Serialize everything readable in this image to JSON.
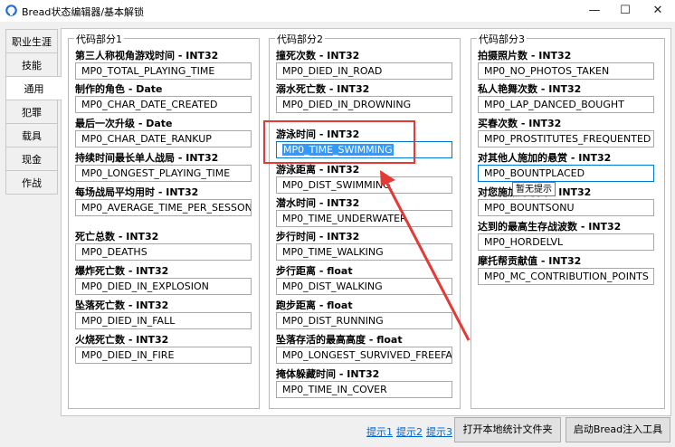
{
  "window": {
    "title": "Bread状态编辑器/基本解锁"
  },
  "tabs": [
    "职业生涯",
    "技能",
    "通用",
    "犯罪",
    "载具",
    "现金",
    "作战"
  ],
  "groups": [
    {
      "legend": "代码部分1",
      "fields": [
        {
          "label": "第三人称视角游戏时间 - INT32",
          "value": "MP0_TOTAL_PLAYING_TIME"
        },
        {
          "label": "制作的角色 - Date",
          "value": "MP0_CHAR_DATE_CREATED"
        },
        {
          "label": "最后一次升级 - Date",
          "value": "MP0_CHAR_DATE_RANKUP"
        },
        {
          "label": "持续时间最长单人战局 - INT32",
          "value": "MP0_LONGEST_PLAYING_TIME"
        },
        {
          "label": "每场战局平均用时 - INT32",
          "value": "MP0_AVERAGE_TIME_PER_SESSON"
        },
        {
          "label": "死亡总数 - INT32",
          "value": "MP0_DEATHS"
        },
        {
          "label": "爆炸死亡数 - INT32",
          "value": "MP0_DIED_IN_EXPLOSION"
        },
        {
          "label": "坠落死亡数 - INT32",
          "value": "MP0_DIED_IN_FALL"
        },
        {
          "label": "火烧死亡数 - INT32",
          "value": "MP0_DIED_IN_FIRE"
        }
      ]
    },
    {
      "legend": "代码部分2",
      "fields": [
        {
          "label": "撞死次数 - INT32",
          "value": "MP0_DIED_IN_ROAD"
        },
        {
          "label": "溺水死亡数 - INT32",
          "value": "MP0_DIED_IN_DROWNING"
        },
        {
          "label": "游泳时间 - INT32",
          "value": "MP0_TIME_SWIMMING"
        },
        {
          "label": "游泳距离 - INT32",
          "value": "MP0_DIST_SWIMMING"
        },
        {
          "label": "潜水时间 - INT32",
          "value": "MP0_TIME_UNDERWATER"
        },
        {
          "label": "步行时间 - INT32",
          "value": "MP0_TIME_WALKING"
        },
        {
          "label": "步行距离 - float",
          "value": "MP0_DIST_WALKING"
        },
        {
          "label": "跑步距离 - float",
          "value": "MP0_DIST_RUNNING"
        },
        {
          "label": "坠落存活的最高高度 - float",
          "value": "MP0_LONGEST_SURVIVED_FREEFALL"
        },
        {
          "label": "掩体躲藏时间 - INT32",
          "value": "MP0_TIME_IN_COVER"
        }
      ]
    },
    {
      "legend": "代码部分3",
      "fields": [
        {
          "label": "拍摄照片数 - INT32",
          "value": "MP0_NO_PHOTOS_TAKEN"
        },
        {
          "label": "私人艳舞次数 - INT32",
          "value": "MP0_LAP_DANCED_BOUGHT"
        },
        {
          "label": "买春次数 - INT32",
          "value": "MP0_PROSTITUTES_FREQUENTED"
        },
        {
          "label": "对其他人施加的悬赏 - INT32",
          "value": "MP0_BOUNTPLACED"
        },
        {
          "label": "对您施加的悬赏 - INT32",
          "value": "MP0_BOUNTSONU"
        },
        {
          "label": "达到的最高生存战波数 - INT32",
          "value": "MP0_HORDELVL"
        },
        {
          "label": "摩托帮贡献值 - INT32",
          "value": "MP0_MC_CONTRIBUTION_POINTS"
        }
      ]
    }
  ],
  "tooltip": "暂无提示",
  "links": [
    "提示1",
    "提示2",
    "提示3"
  ],
  "buttons": {
    "open_stats_folder": "打开本地统计文件夹",
    "launch_injector": "启动Bread注入工具"
  },
  "colors": {
    "annotation_red": "#e53935",
    "selection_blue": "#3399ff",
    "link_blue": "#0066cc"
  }
}
